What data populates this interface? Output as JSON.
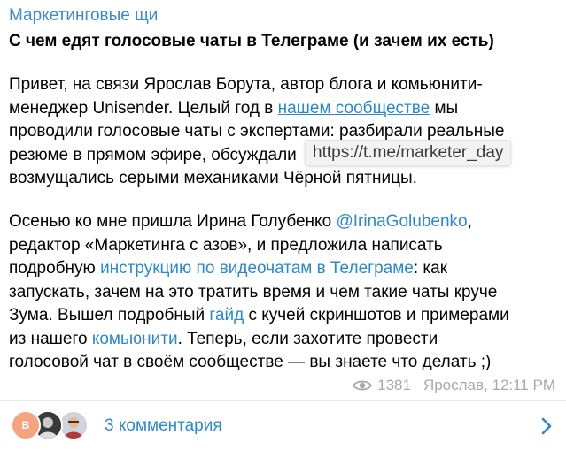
{
  "channel_name": "Маркетинговые щи",
  "post_title": "С чем едят голосовые чаты в Телеграме (и зачем их есть)",
  "paragraph1": {
    "line1": "Привет, на связи Ярослав Борута, автор блога и комьюнити-",
    "line2_pre": "менеджер Unisender. Целый год в ",
    "line2_link": "нашем сообществе",
    "line2_post": " мы",
    "line3": "проводили голосовые чаты с экспертами: разбирали реальные",
    "line4": "резюме в прямом эфире, обсуждали",
    "line5": "возмущались серыми механиками Чёрной пятницы."
  },
  "link_tooltip": "https://t.me/marketer_day",
  "paragraph2": {
    "line1_pre": "Осенью ко мне пришла Ирина Голубенко ",
    "line1_mention": "@IrinaGolubenko",
    "line1_post": ",",
    "line2": "редактор «Маркетинга с азов», и предложила написать",
    "line3_pre": "подробную ",
    "line3_link": "инструкцию по видеочатам в Телеграме",
    "line3_post": ": как",
    "line4": "запускать, зачем на это тратить время и чем такие чаты круче",
    "line5_pre": "Зума. Вышел подробный ",
    "line5_link": "гайд",
    "line5_post": " с кучей скриншотов и примерами",
    "line6_pre": "из нашего ",
    "line6_link": "комьюнити",
    "line6_post": ". Теперь, если захотите провести",
    "line7": "голосовой чат в своём сообществе — вы знаете что делать ;)"
  },
  "meta": {
    "views": "1381",
    "author": "Ярослав",
    "time": "12:11 PM",
    "icon": "eye-icon"
  },
  "comments": {
    "label": "3 комментария",
    "avatar1_initial": "B",
    "icon": "chevron-right-icon"
  },
  "colors": {
    "accent": "#2d88c6",
    "channel": "#3d8bc9",
    "meta": "#a3aab0",
    "avatar1": "#f2a57f"
  }
}
